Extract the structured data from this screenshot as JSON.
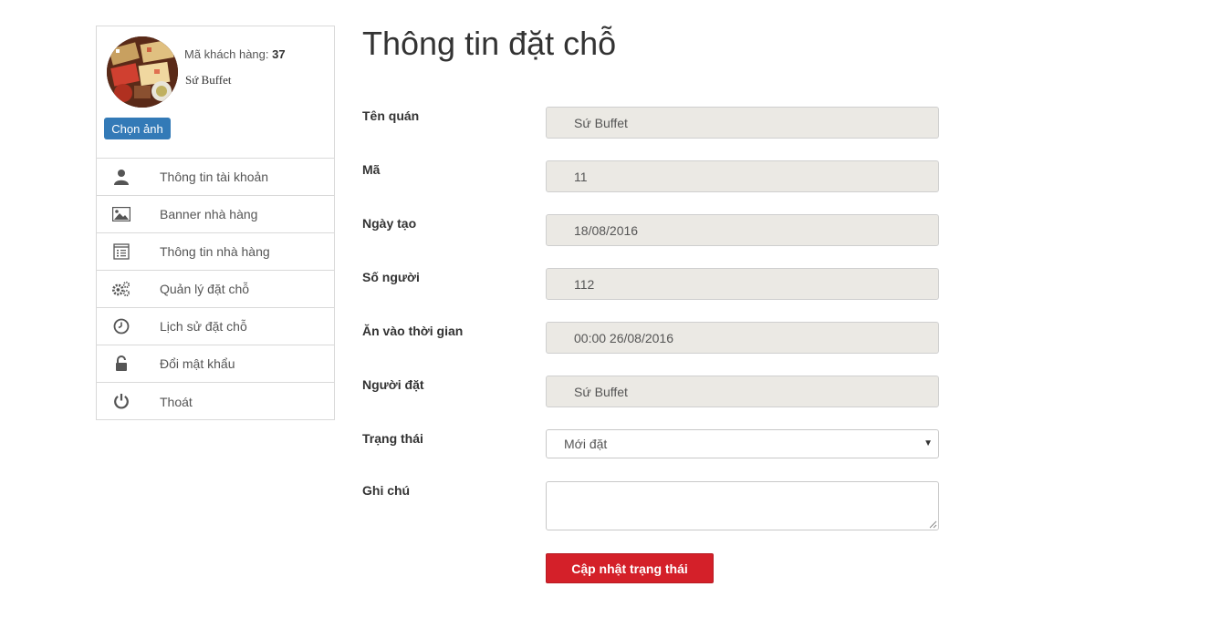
{
  "profile": {
    "customer_id_label": "Mã khách hàng:",
    "customer_id_value": "37",
    "customer_name": "Sứ Buffet",
    "choose_image_label": "Chọn ảnh"
  },
  "menu": {
    "items": [
      {
        "label": "Thông tin tài khoản",
        "icon": "user-icon"
      },
      {
        "label": "Banner nhà hàng",
        "icon": "image-icon"
      },
      {
        "label": "Thông tin nhà hàng",
        "icon": "list-icon"
      },
      {
        "label": "Quản lý đặt chỗ",
        "icon": "gears-icon"
      },
      {
        "label": "Lịch sử đặt chỗ",
        "icon": "clock-icon"
      },
      {
        "label": "Đổi mật khẩu",
        "icon": "unlock-icon"
      },
      {
        "label": "Thoát",
        "icon": "power-icon"
      }
    ]
  },
  "page": {
    "title": "Thông tin đặt chỗ"
  },
  "form": {
    "fields": [
      {
        "label": "Tên quán",
        "value": "Sứ Buffet"
      },
      {
        "label": "Mã",
        "value": "11"
      },
      {
        "label": "Ngày tạo",
        "value": "18/08/2016"
      },
      {
        "label": "Số người",
        "value": "112"
      },
      {
        "label": "Ăn vào thời gian",
        "value": "00:00 26/08/2016"
      },
      {
        "label": "Người đặt",
        "value": "Sứ Buffet"
      }
    ],
    "status_label": "Trạng thái",
    "status_value": "Mới đặt",
    "note_label": "Ghi chú",
    "note_value": "",
    "submit_label": "Cập nhật trạng thái"
  },
  "colors": {
    "primary_button": "#337ab7",
    "submit_button": "#d42029",
    "readonly_field": "#ebe9e4"
  }
}
